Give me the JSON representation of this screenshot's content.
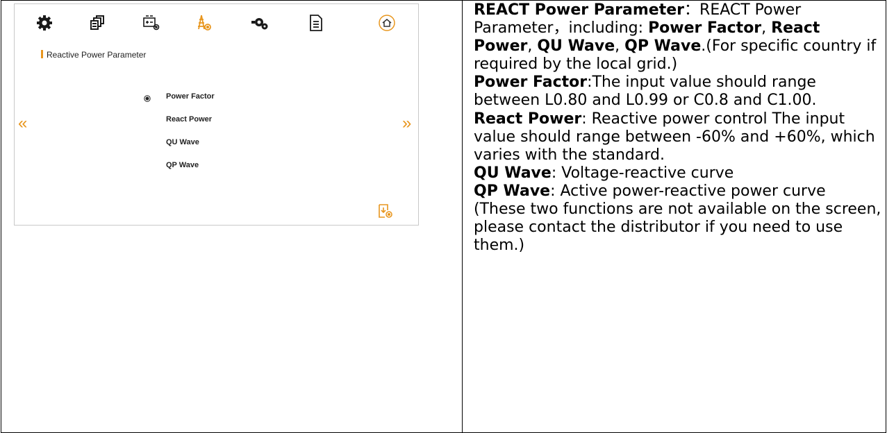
{
  "screen": {
    "title": "Reactive Power Parameter",
    "options": [
      "Power Factor",
      "React Power",
      "QU Wave",
      "QP Wave"
    ],
    "selected_option": "Power Factor",
    "nav_prev": "«",
    "nav_next": "»",
    "toolbar_icons": [
      "gear-icon",
      "stacked-devices-icon",
      "battery-settings-icon",
      "grid-tower-icon",
      "generator-icon",
      "document-icon",
      "home-icon"
    ],
    "accent_color": "#e8961e"
  },
  "desc": {
    "react_heading": "REACT Power Parameter",
    "react_sep": "：",
    "react_text": "REACT Power Parameter，including: ",
    "opt1": "Power Factor",
    "c1": ", ",
    "opt2": "React Power",
    "c2": ", ",
    "opt3": "QU Wave",
    "c3": ", ",
    "opt4": "QP Wave",
    "react_tail": ".(For specific country if required by the local grid.)",
    "pf_label": "Power Factor",
    "pf_text": ":The input value should range between L0.80 and L0.99 or C0.8 and C1.00.",
    "rp_label": "React Power",
    "rp_text": ": Reactive power control The input value should range between -60% and +60%, which varies with the standard.",
    "qu_label": "QU Wave",
    "qu_text": ": Voltage-reactive curve",
    "qp_label": "QP Wave",
    "qp_text": ": Active power-reactive power curve",
    "note": "(These two functions are not available on the screen, please contact the distributor if you need to use them.)"
  }
}
